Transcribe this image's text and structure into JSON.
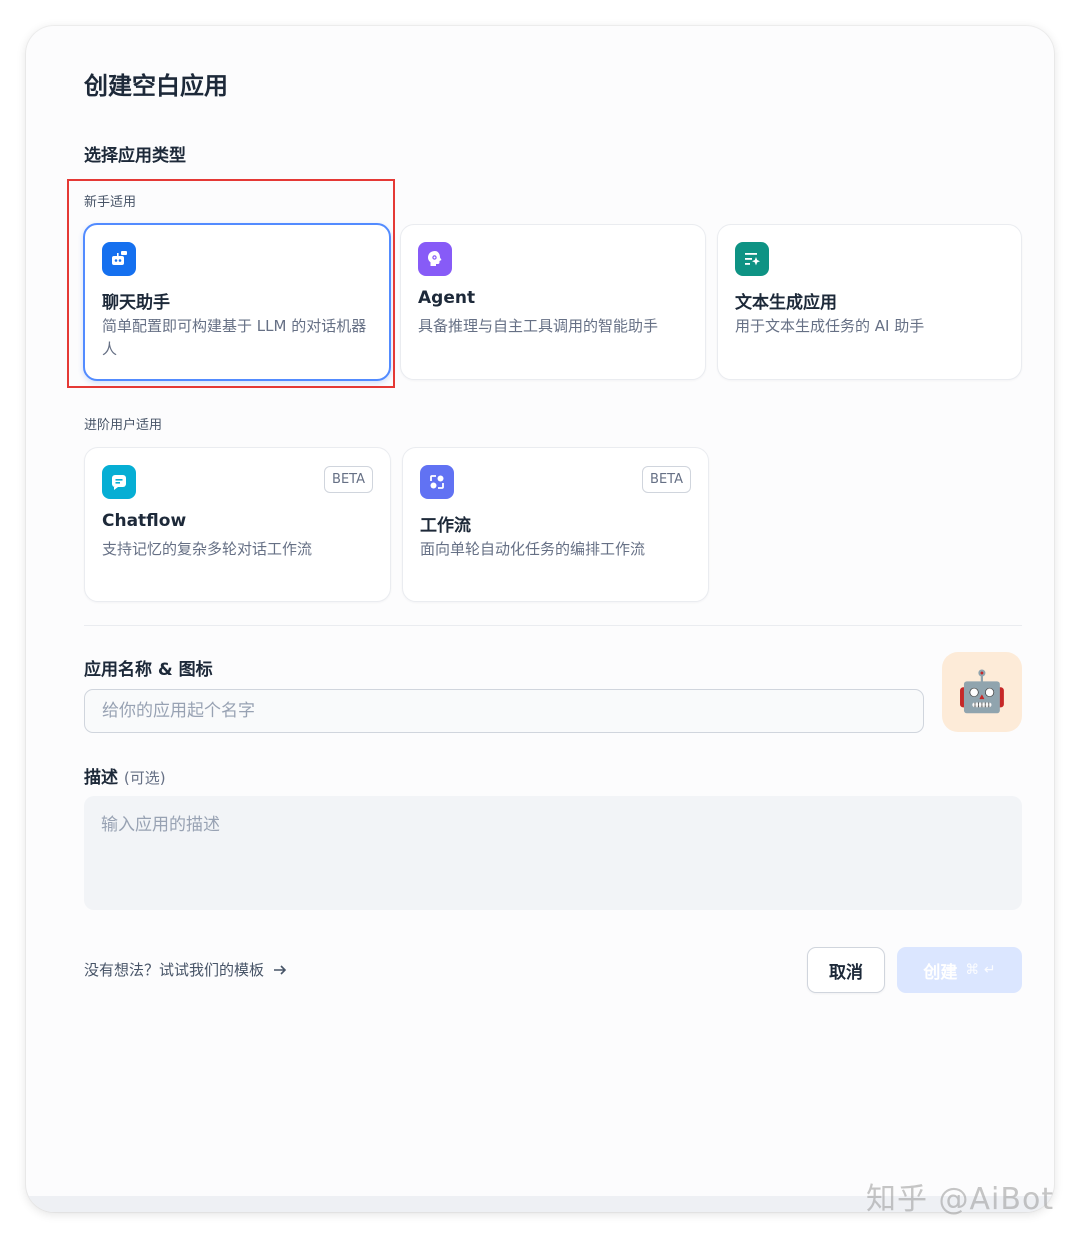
{
  "dialog": {
    "title": "创建空白应用",
    "section_label": "选择应用类型",
    "beginner_label": "新手适用",
    "advanced_label": "进阶用户适用"
  },
  "cards": {
    "chat": {
      "title": "聊天助手",
      "desc": "简单配置即可构建基于 LLM 的对话机器人",
      "icon": "chat-bot-icon",
      "color": "#1570ef"
    },
    "agent": {
      "title": "Agent",
      "desc": "具备推理与自主工具调用的智能助手",
      "icon": "agent-brain-icon",
      "color": "#875bf7"
    },
    "text": {
      "title": "文本生成应用",
      "desc": "用于文本生成任务的 AI 助手",
      "icon": "text-generation-icon",
      "color": "#0e9384"
    },
    "chatflow": {
      "title": "Chatflow",
      "desc": "支持记忆的复杂多轮对话工作流",
      "badge": "BETA",
      "icon": "chatflow-icon",
      "color": "#06aed4"
    },
    "workflow": {
      "title": "工作流",
      "desc": "面向单轮自动化任务的编排工作流",
      "badge": "BETA",
      "icon": "workflow-icon",
      "color": "#6172f3"
    }
  },
  "form": {
    "name_label": "应用名称 & 图标",
    "name_placeholder": "给你的应用起个名字",
    "name_value": "",
    "avatar_icon": "robot-emoji",
    "avatar_emoji": "🤖",
    "desc_label": "描述",
    "desc_optional": "(可选)",
    "desc_placeholder": "输入应用的描述"
  },
  "footer": {
    "template_link": "没有想法？试试我们的模板",
    "cancel_label": "取消",
    "create_label": "创建",
    "create_shortcut": "⌘ ↵"
  },
  "watermark": "知乎 @AiBot"
}
